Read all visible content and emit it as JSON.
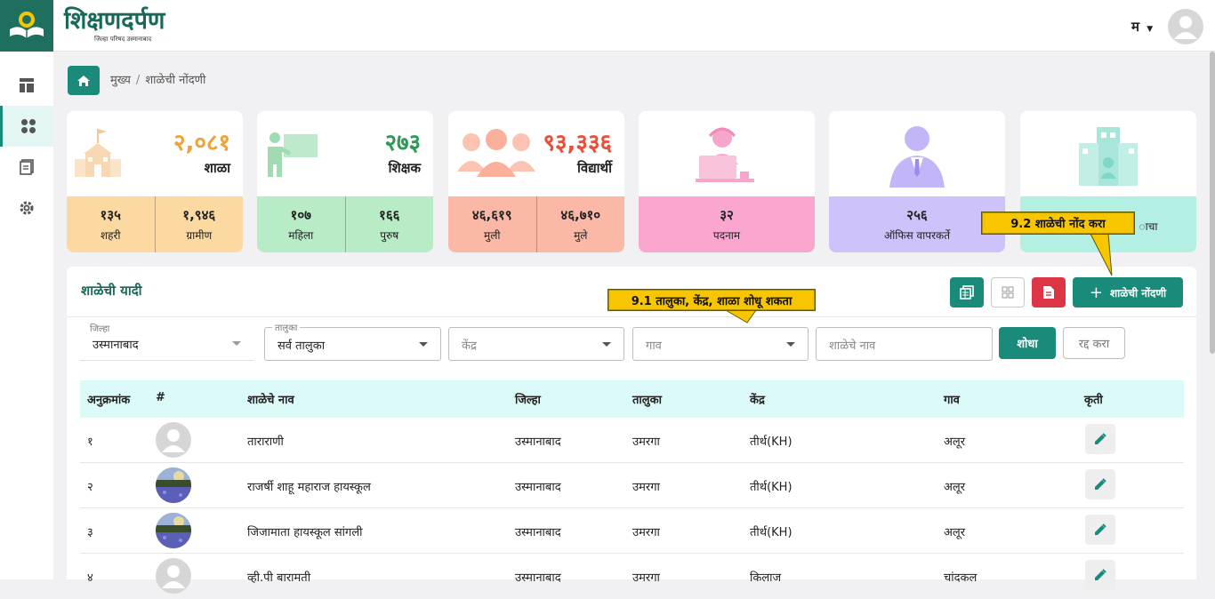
{
  "app": {
    "brand_title": "शिक्षणदर्पण",
    "brand_subtitle": "जिल्हा परिषद उस्मानाबाद",
    "language": "म"
  },
  "breadcrumb": {
    "home": "मुख्य",
    "current": "शाळेची नोंदणी"
  },
  "stats": [
    {
      "value": "२,०८१",
      "label": "शाळा",
      "value_color": "#f0a13a",
      "bottom_color": "#fcd9a0",
      "bottom": [
        {
          "value": "१३५",
          "label": "शहरी"
        },
        {
          "value": "१,९४६",
          "label": "ग्रामीण"
        }
      ]
    },
    {
      "value": "२७३",
      "label": "शिक्षक",
      "value_color": "#2e9a55",
      "bottom_color": "#b8ecc6",
      "bottom": [
        {
          "value": "१०७",
          "label": "महिला"
        },
        {
          "value": "१६६",
          "label": "पुरुष"
        }
      ]
    },
    {
      "value": "९३,३३६",
      "label": "विद्यार्थी",
      "value_color": "#e8503a",
      "bottom_color": "#fbb8a6",
      "bottom": [
        {
          "value": "४६,६१९",
          "label": "मुली"
        },
        {
          "value": "४६,७१०",
          "label": "मुले"
        }
      ]
    },
    {
      "value": "",
      "label": "",
      "bottom_color": "#fba6cf",
      "bottom": [
        {
          "value": "३२",
          "label": "पदनाम"
        }
      ]
    },
    {
      "value": "",
      "label": "",
      "bottom_color": "#cfc2fb",
      "bottom": [
        {
          "value": "२५६",
          "label": "ऑफिस वापरकर्ते"
        }
      ]
    },
    {
      "value": "",
      "label": "",
      "bottom_color": "#b3efe2",
      "bottom": [
        {
          "value": "",
          "label": "ाचा"
        }
      ]
    }
  ],
  "list": {
    "title": "शाळेची यादी",
    "add_button": "शाळेची नोंदणी"
  },
  "filters": {
    "district_label": "जिल्हा",
    "district_value": "उस्मानाबाद",
    "taluka_label": "तालुका",
    "taluka_value": "सर्व तालुका",
    "center_placeholder": "केंद्र",
    "village_placeholder": "गाव",
    "school_placeholder": "शाळेचे नाव",
    "search_button": "शोधा",
    "cancel_button": "रद्द करा"
  },
  "table": {
    "headers": [
      "अनुक्रमांक",
      "#",
      "शाळेचे नाव",
      "जिल्हा",
      "तालुका",
      "केंद्र",
      "गाव",
      "कृती"
    ],
    "rows": [
      {
        "sr": "१",
        "name": "ताराराणी",
        "district": "उस्मानाबाद",
        "taluka": "उमरगा",
        "center": "तीर्थ(KH)",
        "village": "अलूर",
        "avatar": "placeholder"
      },
      {
        "sr": "२",
        "name": "राजर्षी शाहू महाराज हायस्कूल",
        "district": "उस्मानाबाद",
        "taluka": "उमरगा",
        "center": "तीर्थ(KH)",
        "village": "अलूर",
        "avatar": "photo"
      },
      {
        "sr": "३",
        "name": "जिजामाता हायस्कूल सांगली",
        "district": "उस्मानाबाद",
        "taluka": "उमरगा",
        "center": "तीर्थ(KH)",
        "village": "अलूर",
        "avatar": "photo"
      },
      {
        "sr": "४",
        "name": "व्ही.पी बारामती",
        "district": "उस्मानाबाद",
        "taluka": "उमरगा",
        "center": "किलाज",
        "village": "चांदकल",
        "avatar": "placeholder"
      }
    ]
  },
  "callouts": {
    "search_hint": "9.1 तालुका, केंद्र, शाळा शोधू शकता",
    "register_hint": "9.2 शाळेची नोंद करा"
  }
}
